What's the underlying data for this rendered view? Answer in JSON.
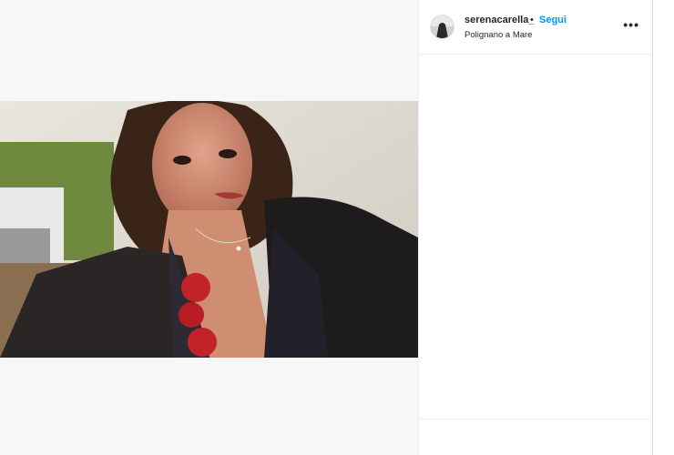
{
  "post": {
    "author": {
      "username": "serenacarella_",
      "location": "Polignano a Mare",
      "follow_label": "Segui",
      "separator": "•"
    },
    "icons": {
      "more": "more-options-icon",
      "avatar": "avatar"
    },
    "more_label": "•••",
    "colors": {
      "follow": "#0095f6",
      "text": "#262626",
      "border": "#efefef"
    }
  }
}
